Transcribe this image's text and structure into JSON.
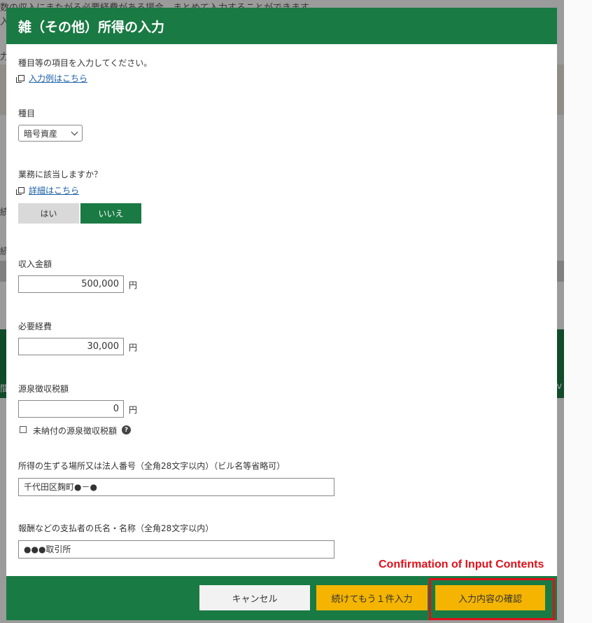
{
  "background": {
    "line1": "数の収入にまたがる必要経費がある場合、まとめて入力することができます。",
    "line2": "入",
    "line3": "力",
    "line4": "続",
    "line5": "続",
    "line6": "間",
    "line7": "rv"
  },
  "modal": {
    "title": "雑（その他）所得の入力",
    "intro": "種目等の項目を入力してください。",
    "example_link": "入力例はこちら",
    "category": {
      "label": "種目",
      "selected": "暗号資産"
    },
    "business": {
      "question": "業務に該当しますか？",
      "detail_link": "詳細はこちら",
      "yes_label": "はい",
      "no_label": "いいえ",
      "selected": "いいえ"
    },
    "income": {
      "label": "収入金額",
      "value": "500,000",
      "unit": "円"
    },
    "expenses": {
      "label": "必要経費",
      "value": "30,000",
      "unit": "円"
    },
    "withholding": {
      "label": "源泉徴収税額",
      "value": "0",
      "unit": "円",
      "unpaid_checkbox_label": "未納付の源泉徴収税額",
      "unpaid_checked": false,
      "help_glyph": "?"
    },
    "location": {
      "label": "所得の生ずる場所又は法人番号（全角28文字以内）（ビル名等省略可）",
      "value": "千代田区麹町●－●"
    },
    "payer": {
      "label": "報酬などの支払者の氏名・名称（全角28文字以内）",
      "value": "●●●取引所"
    },
    "footer": {
      "cancel": "キャンセル",
      "add_another": "続けてもう１件入力",
      "confirm": "入力内容の確認"
    }
  },
  "annotation": {
    "text": "Confirmation of Input Contents",
    "color": "#e0101a"
  },
  "colors": {
    "header_green": "#1a7a44",
    "button_yellow": "#f4b400",
    "link_blue": "#1a5fa8"
  }
}
